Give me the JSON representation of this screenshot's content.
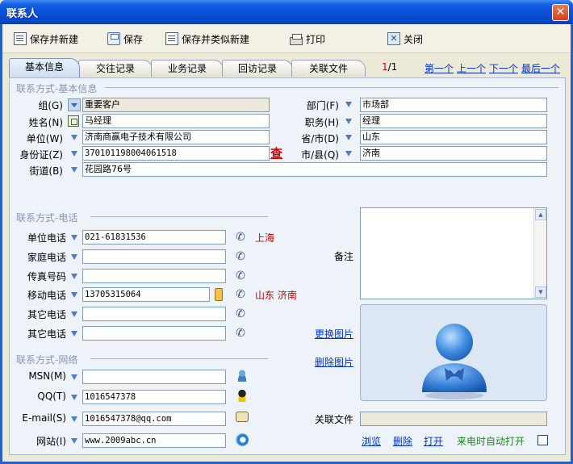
{
  "window": {
    "title": "联系人",
    "close_glyph": "✕"
  },
  "toolbar": {
    "save_new": "保存并新建",
    "save": "保存",
    "save_similar": "保存并类似新建",
    "print": "打印",
    "close": "关闭"
  },
  "tabs": [
    {
      "label": "基本信息",
      "active": true
    },
    {
      "label": "交往记录",
      "active": false
    },
    {
      "label": "业务记录",
      "active": false
    },
    {
      "label": "回访记录",
      "active": false
    },
    {
      "label": "关联文件",
      "active": false
    }
  ],
  "pager": {
    "current": "1",
    "total": "/1",
    "first": "第一个",
    "prev": "上一个",
    "next": "下一个",
    "last": "最后一个"
  },
  "sections": {
    "basic": "联系方式-基本信息",
    "phone": "联系方式-电话",
    "network": "联系方式-网络"
  },
  "basic": {
    "group_label": "组(G)",
    "group_value": "重要客户",
    "name_label": "姓名(N)",
    "name_value": "马经理",
    "company_label": "单位(W)",
    "company_value": "济南商赢电子技术有限公司",
    "id_label": "身份证(Z)",
    "id_value": "370101198004061518",
    "id_check": "查",
    "street_label": "街道(B)",
    "street_value": "花园路76号",
    "dept_label": "部门(F)",
    "dept_value": "市场部",
    "title_label": "职务(H)",
    "title_value": "经理",
    "province_label": "省/市(D)",
    "province_value": "山东",
    "city_label": "市/县(Q)",
    "city_value": "济南"
  },
  "phones": [
    {
      "label": "单位电话",
      "value": "021-61831536",
      "location": "上海"
    },
    {
      "label": "家庭电话",
      "value": "",
      "location": ""
    },
    {
      "label": "传真号码",
      "value": "",
      "location": ""
    },
    {
      "label": "移动电话",
      "value": "13705315064",
      "location": "山东 济南"
    },
    {
      "label": "其它电话",
      "value": "",
      "location": ""
    },
    {
      "label": "其它电话",
      "value": "",
      "location": ""
    }
  ],
  "network": {
    "msn_label": "MSN(M)",
    "msn_value": "",
    "qq_label": "QQ(T)",
    "qq_value": "1016547378",
    "email_label": "E-mail(S)",
    "email_value": "1016547378@qq.com",
    "site_label": "网站(I)",
    "site_value": "www.2009abc.cn"
  },
  "right": {
    "notes_label": "备注",
    "change_photo": "更换图片",
    "delete_photo": "删除图片",
    "linked_file_label": "关联文件",
    "browse": "浏览",
    "delete": "删除",
    "open": "打开",
    "auto_open": "来电时自动打开"
  },
  "colors": {
    "accent": "#0a4fd5",
    "link": "#0033cc",
    "location": "#cc0000",
    "green": "#1a8a1a"
  }
}
